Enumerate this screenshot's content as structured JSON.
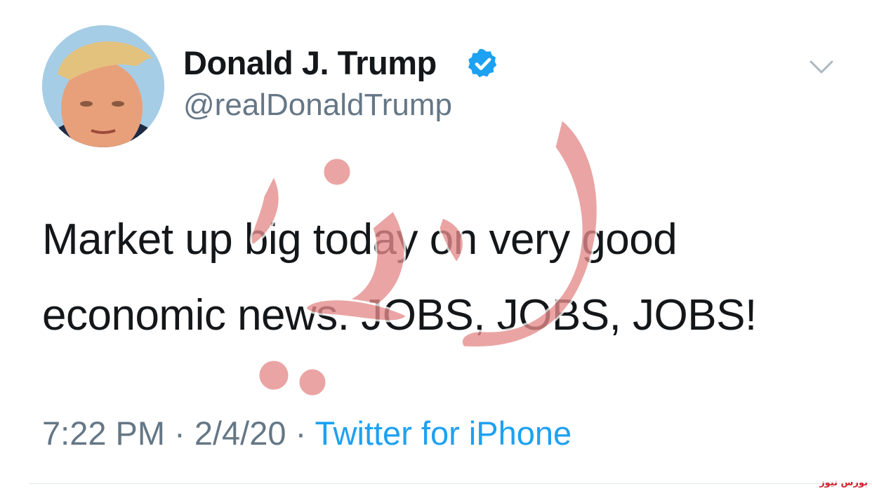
{
  "author": {
    "display_name": "Donald J. Trump",
    "handle": "@realDonaldTrump",
    "verified": true,
    "avatar_icon": "profile-photo"
  },
  "tweet": {
    "text": "Market up big today on very good economic news. JOBS, JOBS, JOBS!"
  },
  "meta": {
    "time": "7:22 PM",
    "separator": " · ",
    "date": "2/4/20",
    "source": "Twitter for iPhone"
  },
  "menu": {
    "icon": "chevron-down-icon"
  },
  "watermark": {
    "text": "بورس نیوز",
    "corner_text": "بورس نیوز"
  },
  "colors": {
    "text": "#14171a",
    "secondary": "#657786",
    "link": "#1da1f2",
    "verified": "#1da1f2",
    "watermark": "#e58b8b",
    "corner_mark": "#d2202f"
  }
}
